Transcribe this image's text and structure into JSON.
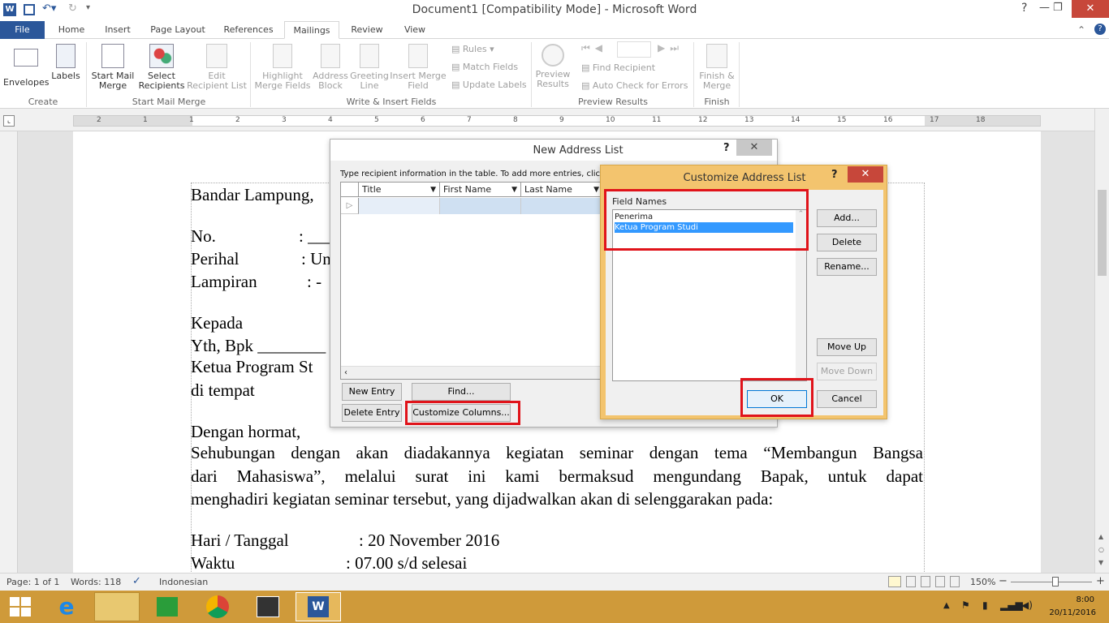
{
  "window": {
    "title": "Document1 [Compatibility Mode] - Microsoft Word",
    "help": "?",
    "minimize": "—",
    "restore": "❐",
    "close": "✕"
  },
  "tabs": [
    "File",
    "Home",
    "Insert",
    "Page Layout",
    "References",
    "Mailings",
    "Review",
    "View"
  ],
  "ribbon": {
    "envelopes": "Envelopes",
    "labels": "Labels",
    "create_group": "Create",
    "start_mail_merge": "Start Mail Merge",
    "select_recipients": "Select Recipients",
    "edit_recipient_list": "Edit Recipient List",
    "start_group": "Start Mail Merge",
    "highlight": "Highlight Merge Fields",
    "address_block": "Address Block",
    "greeting_line": "Greeting Line",
    "insert_merge_field": "Insert Merge Field",
    "rules": "Rules",
    "match_fields": "Match Fields",
    "update_labels": "Update Labels",
    "write_group": "Write & Insert Fields",
    "preview_results": "Preview Results",
    "find_recipient": "Find Recipient",
    "auto_check": "Auto Check for Errors",
    "preview_group": "Preview Results",
    "finish_merge": "Finish & Merge",
    "finish_group": "Finish"
  },
  "ruler_numbers": [
    "2",
    "1",
    "1",
    "2",
    "3",
    "4",
    "5",
    "6",
    "7",
    "8",
    "9",
    "10",
    "11",
    "12",
    "13",
    "14",
    "15",
    "16",
    "17",
    "18"
  ],
  "document": {
    "line1": "Bandar Lampung,",
    "no": "No.",
    "no_val": ": ___",
    "perihal": "Perihal",
    "perihal_val": ": Un",
    "lampiran": "Lampiran",
    "lampiran_val": ": -",
    "kepada": "Kepada",
    "yth": "Yth, Bpk ________",
    "ketua": "Ketua Program St",
    "ditempat": "di tempat",
    "hormat": "Dengan hormat,",
    "para1": "Sehubungan dengan akan diadakannya kegiatan seminar dengan tema “Membangun Bangsa",
    "para2": "dari Mahasiswa”, melalui surat ini kami bermaksud mengundang Bapak, untuk dapat",
    "para3": "menghadiri kegiatan seminar tersebut, yang dijadwalkan akan di selenggarakan pada:",
    "hari": "Hari / Tanggal",
    "hari_val": ": 20 November 2016",
    "waktu": "Waktu",
    "waktu_val": ": 07.00 s/d selesai"
  },
  "new_address_list": {
    "title": "New Address List",
    "help": "?",
    "close": "✕",
    "instruction": "Type recipient information in the table.  To add more entries, click N",
    "columns": [
      "Title",
      "First Name",
      "Last Name"
    ],
    "new_entry": "New Entry",
    "find": "Find...",
    "delete_entry": "Delete Entry",
    "customize_columns": "Customize Columns..."
  },
  "customize_dialog": {
    "title": "Customize Address List",
    "help": "?",
    "close": "✕",
    "field_names_label": "Field Names",
    "fields": [
      "Penerima",
      "Ketua Program Studi"
    ],
    "selected_index": 1,
    "add": "Add...",
    "delete": "Delete",
    "rename": "Rename...",
    "move_up": "Move Up",
    "move_down": "Move Down",
    "ok": "OK",
    "cancel": "Cancel"
  },
  "status": {
    "page": "Page: 1 of 1",
    "words": "Words: 118",
    "language": "Indonesian",
    "zoom": "150%",
    "zoom_minus": "−",
    "zoom_plus": "+"
  },
  "taskbar": {
    "time": "8:00",
    "date": "20/11/2016"
  }
}
